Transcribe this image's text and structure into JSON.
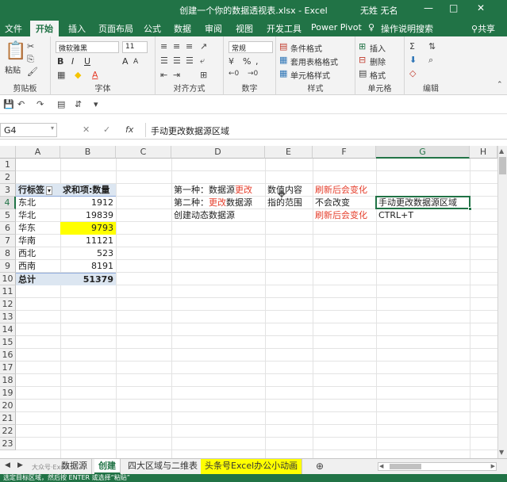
{
  "window": {
    "title": "创建一个你的数据透视表.xlsx - Excel",
    "user": "无姓 无名",
    "min": "—",
    "max": "□",
    "close": "✕"
  },
  "tabs": [
    "文件",
    "开始",
    "插入",
    "页面布局",
    "公式",
    "数据",
    "审阅",
    "视图",
    "开发工具",
    "Power Pivot"
  ],
  "active_tab": "开始",
  "tell_me": "操作说明搜索",
  "share": "共享",
  "ribbon": {
    "clipboard": {
      "label": "剪贴板",
      "paste": "粘贴"
    },
    "font": {
      "label": "字体",
      "name": "微软雅黑",
      "size": "11",
      "bold": "B",
      "italic": "I",
      "underline": "U",
      "grow": "A",
      "shrink": "A",
      "color": "A"
    },
    "align": {
      "label": "对齐方式"
    },
    "number": {
      "label": "数字",
      "format": "常规",
      "pct": "%",
      "comma": ","
    },
    "styles": {
      "label": "样式",
      "cond": "条件格式",
      "table": "套用表格格式",
      "cell": "单元格样式"
    },
    "cells": {
      "label": "单元格",
      "insert": "插入",
      "delete": "删除",
      "format": "格式"
    },
    "editing": {
      "label": "编辑"
    }
  },
  "formula_bar": {
    "name_box": "G4",
    "fx": "fx",
    "value": "手动更改数据源区域"
  },
  "columns": [
    "A",
    "B",
    "C",
    "D",
    "E",
    "F",
    "G",
    "H"
  ],
  "rows": [
    "1",
    "2",
    "3",
    "4",
    "5",
    "6",
    "7",
    "8",
    "9",
    "10",
    "11",
    "12",
    "13",
    "14",
    "15",
    "16",
    "17",
    "18",
    "19",
    "20",
    "21",
    "22",
    "23"
  ],
  "pivot": {
    "header_label": "行标签",
    "header_value": "求和项:数量",
    "rows": [
      {
        "label": "东北",
        "value": "1912"
      },
      {
        "label": "华北",
        "value": "19839"
      },
      {
        "label": "华东",
        "value": "9793"
      },
      {
        "label": "华南",
        "value": "11121"
      },
      {
        "label": "西北",
        "value": "523"
      },
      {
        "label": "西南",
        "value": "8191"
      }
    ],
    "total_label": "总计",
    "total_value": "51379"
  },
  "notes": {
    "d3a": "第一种：数据源",
    "d3b": "更改",
    "e3": "数值内容",
    "f3": "刷新后会变化",
    "d4a": "第二种：",
    "d4b": "更改",
    "d4c": "数据源",
    "e4": "指的范围",
    "f4": "不会改变",
    "g4": "手动更改数据源区域",
    "d5": "创建动态数据源",
    "f5": "刷新后会变化",
    "g5": "CTRL+T"
  },
  "sheet_tabs": [
    "数据源",
    "创建",
    "四大区域与二维表",
    "头条号Excel办公小动画"
  ],
  "active_sheet": "创建",
  "status": "选定目标区域，然后按 ENTER 或选择“粘贴”",
  "watermark": "大众号·Excel",
  "colors": {
    "excel_green": "#217346",
    "highlight": "#ffff00",
    "red_text": "#e53e2b",
    "pivot_header": "#dce6f1"
  }
}
